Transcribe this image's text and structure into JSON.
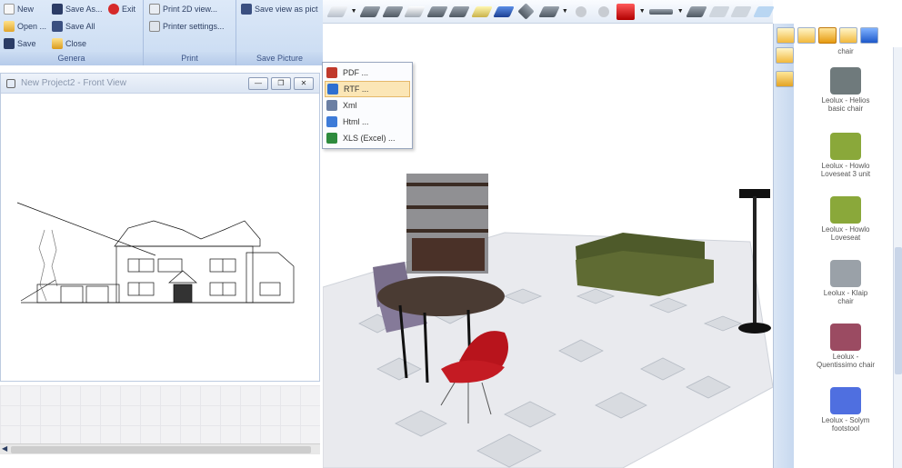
{
  "ribbon": {
    "general": {
      "label": "Genera",
      "new": "New",
      "open": "Open ...",
      "save": "Save",
      "save_as": "Save As...",
      "save_all": "Save All",
      "close": "Close",
      "exit": "Exit"
    },
    "print": {
      "label": "Print",
      "print_2d": "Print 2D view...",
      "printer_settings": "Printer settings..."
    },
    "save_picture": {
      "label": "Save Picture",
      "save_view": "Save view as pict"
    }
  },
  "plan_window": {
    "title": "New Project2 - Front View",
    "minimize": "—",
    "restore": "❐",
    "close": "✕"
  },
  "export_menu": {
    "items": [
      {
        "label": "PDF ...",
        "icon": "pdf-icon",
        "color": "#c0392b"
      },
      {
        "label": "RTF ...",
        "icon": "rtf-icon",
        "color": "#2e6fd1"
      },
      {
        "label": "Xml",
        "icon": "xml-icon",
        "color": "#6b7fa3"
      },
      {
        "label": "Html ...",
        "icon": "html-icon",
        "color": "#3d7bd8"
      },
      {
        "label": "XLS (Excel) ...",
        "icon": "excel-icon",
        "color": "#2e8b3d"
      }
    ]
  },
  "library": {
    "items": [
      {
        "label": "chair",
        "color": "#7f8a8c"
      },
      {
        "label": "Leolux - Helios\nbasic chair",
        "color": "#6f7a7c"
      },
      {
        "label": "Leolux - Howlo\nLoveseat 3 unit",
        "color": "#8aa83a"
      },
      {
        "label": "Leolux - Howlo\nLoveseat",
        "color": "#8aa83a"
      },
      {
        "label": "Leolux - Klaip\nchair",
        "color": "#9aa1a8"
      },
      {
        "label": "Leolux -\nQuentissimo chair",
        "color": "#9b4b62"
      },
      {
        "label": "Leolux - Solym\nfootstool",
        "color": "#4f6fe0"
      }
    ]
  },
  "colors": {
    "ribbon_bg": "#d6e4f6",
    "floor": "#e9eaee",
    "sofa": "#4e5a2a",
    "chair_red": "#b8141c",
    "chair_purple": "#7a6f8c",
    "table_top": "#4a3b33"
  }
}
